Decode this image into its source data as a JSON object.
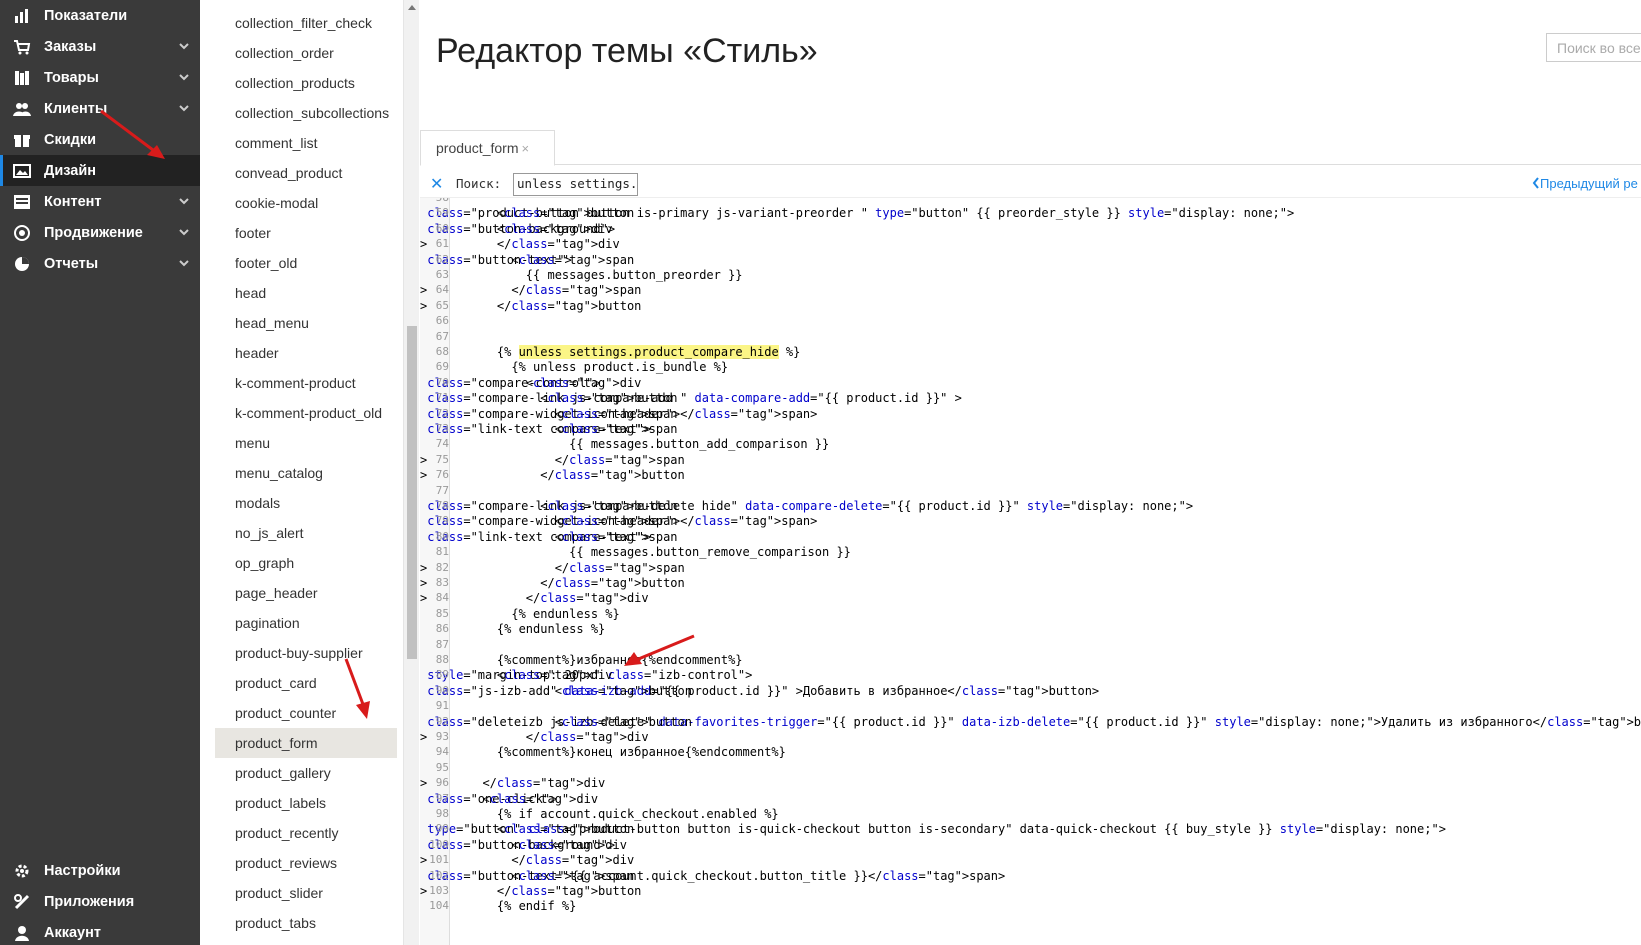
{
  "nav": {
    "items": [
      {
        "label": "Показатели",
        "icon": "bar-chart-icon",
        "chevron": false
      },
      {
        "label": "Заказы",
        "icon": "cart-icon",
        "chevron": true
      },
      {
        "label": "Товары",
        "icon": "books-icon",
        "chevron": true
      },
      {
        "label": "Клиенты",
        "icon": "users-icon",
        "chevron": true
      },
      {
        "label": "Скидки",
        "icon": "gift-icon",
        "chevron": false
      },
      {
        "label": "Дизайн",
        "icon": "image-icon",
        "chevron": false,
        "active": true
      },
      {
        "label": "Контент",
        "icon": "content-icon",
        "chevron": true
      },
      {
        "label": "Продвижение",
        "icon": "promo-icon",
        "chevron": true
      },
      {
        "label": "Отчеты",
        "icon": "pie-chart-icon",
        "chevron": true
      }
    ],
    "bottom": [
      {
        "label": "Настройки",
        "icon": "gear-icon"
      },
      {
        "label": "Приложения",
        "icon": "puzzle-icon"
      },
      {
        "label": "Аккаунт",
        "icon": "account-icon"
      }
    ]
  },
  "templates": [
    "collection_filter_check",
    "collection_order",
    "collection_products",
    "collection_subcollections",
    "comment_list",
    "convead_product",
    "cookie-modal",
    "footer",
    "footer_old",
    "head",
    "head_menu",
    "header",
    "k-comment-product",
    "k-comment-product_old",
    "menu",
    "menu_catalog",
    "modals",
    "no_js_alert",
    "op_graph",
    "page_header",
    "pagination",
    "product-buy-supplier",
    "product_card",
    "product_counter",
    "product_form",
    "product_gallery",
    "product_labels",
    "product_recently",
    "product_reviews",
    "product_slider",
    "product_tabs"
  ],
  "active_template": "product_form",
  "main": {
    "title": "Редактор темы «Стиль»",
    "global_search_placeholder": "Поиск во все",
    "tab_label": "product_form",
    "tab_close": "×",
    "search_close": "✕",
    "search_label": "Поиск:",
    "search_value": "unless settings.pr",
    "prev_label": "Предыдущий  ре"
  },
  "code": {
    "first_line": 58,
    "lines": [
      "",
      "    <button class=\"product-button button is-primary js-variant-preorder \" type=\"button\" {{ preorder_style }} style=\"display: none;\">",
      "    <div class=\"button-background\">",
      "    </div>",
      "      <span class=\"button-text\">",
      "        {{ messages.button_preorder }}",
      "      </span>",
      "    </button>",
      "",
      "",
      "    {% unless settings.product_compare_hide %}",
      "      {% unless product.is_bundle %}",
      "        <div class=\"compare-control\">",
      "          <button class=\"compare-link js-compare-add \" data-compare-add=\"{{ product.id }}\" >",
      "            <span class=\"compare-widget-icon-header\"></span>",
      "            <span class=\"link-text compare-text\">",
      "              {{ messages.button_add_comparison }}",
      "            </span>",
      "          </button>",
      "",
      "          <button class=\"compare-link js-compare-delete hide\" data-compare-delete=\"{{ product.id }}\" style=\"display: none;\">",
      "            <span class=\"compare-widget-icon-header\"></span>",
      "            <span class=\"link-text compare-text\">",
      "              {{ messages.button_remove_comparison }}",
      "            </span>",
      "          </button>",
      "        </div>",
      "      {% endunless %}",
      "    {% endunless %}",
      "",
      "    {%comment%}избранное{%endcomment%}",
      "    <div style=\"margin-top: 20px\" class=\"izb-control\">",
      "            <button class=\"js-izb-add\" data-izb-add=\"{{ product.id }}\" >Добавить в избранное</button>",
      "",
      "            <button class=\"deleteizb js-izb-delete\" data-favorites-trigger=\"{{ product.id }}\" data-izb-delete=\"{{ product.id }}\" style=\"display: none;\">Удалить из избранного</button>",
      "        </div>",
      "    {%comment%}конец избранное{%endcomment%}",
      "",
      "  </div>",
      "  <div class=\"one-click\">",
      "    {% if account.quick_checkout.enabled %}",
      "    <button type=\"button\" class=\"product-button button is-quick-checkout button is-secondary\" data-quick-checkout {{ buy_style }} style=\"display: none;\">",
      "      <div class=\"button-background\">",
      "      </div>",
      "      <span class=\"button-text\">{{ account.quick_checkout.button_title }}</span>",
      "    </button>",
      "    {% endif %}"
    ],
    "highlight_line": 68,
    "highlight_text": "unless settings.product_compare_hide"
  }
}
